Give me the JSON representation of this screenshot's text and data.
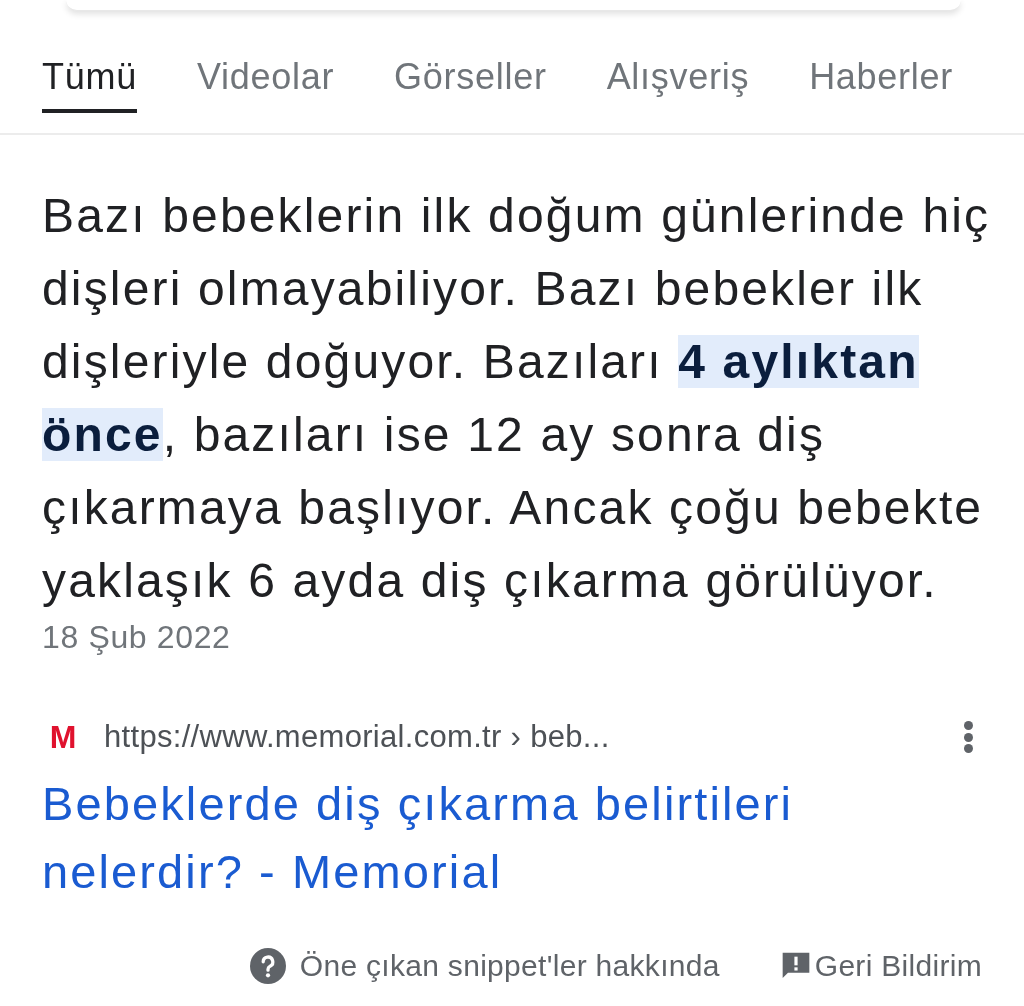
{
  "tabs": [
    {
      "label": "Tümü",
      "selected": true
    },
    {
      "label": "Videolar",
      "selected": false
    },
    {
      "label": "Görseller",
      "selected": false
    },
    {
      "label": "Alışveriş",
      "selected": false
    },
    {
      "label": "Haberler",
      "selected": false
    }
  ],
  "snippet": {
    "text": "Bazı bebeklerin ilk doğum günlerinde hiç dişleri olmayabiliyor. Bazı bebekler ilk dişleriyle doğuyor. Bazıları **4 aylıktan önce**, bazıları ise 12 ay sonra diş çıkarmaya başlıyor. Ancak çoğu bebekte yaklaşık 6 ayda diş çıkarma görülüyor.",
    "date": "18 Şub 2022"
  },
  "source": {
    "logo_letter": "M",
    "url": "https://www.memorial.com.tr › beb...",
    "title": "Bebeklerde diş çıkarma belirtileri nelerdir? - Memorial"
  },
  "footer": {
    "about": "Öne çıkan snippet'ler hakkında",
    "feedback": "Geri Bildirim"
  }
}
